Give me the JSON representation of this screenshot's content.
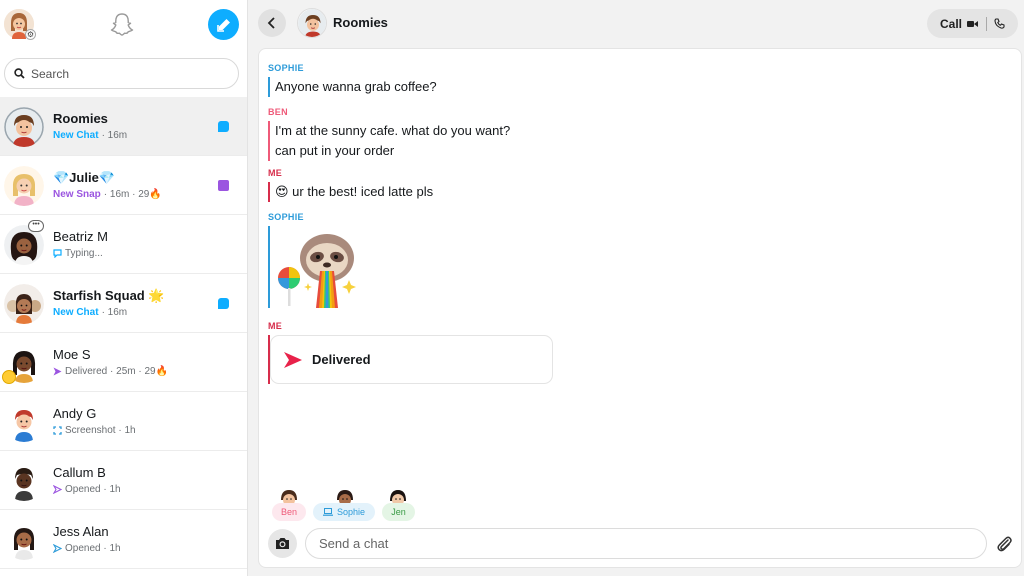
{
  "sidebar": {
    "search_placeholder": "Search",
    "chats": [
      {
        "name": "Roomies",
        "status_label": "New Chat",
        "status_meta": " · 16m",
        "indicator": "blue",
        "active": true,
        "bold": true,
        "label_color": "blue",
        "status_icon": "none"
      },
      {
        "name": "💎Julie💎",
        "status_label": "New Snap",
        "status_meta": " · 16m · 29🔥",
        "indicator": "purple",
        "active": false,
        "bold": true,
        "label_color": "purple",
        "status_icon": "none"
      },
      {
        "name": "Beatriz M",
        "status_label": "",
        "status_meta": "Typing...",
        "indicator": "none",
        "active": false,
        "bold": false,
        "label_color": "grey",
        "status_icon": "typing-chat-icon"
      },
      {
        "name": "Starfish Squad",
        "status_label": "New Chat",
        "status_meta": " · 16m",
        "indicator": "blue",
        "active": false,
        "bold": true,
        "label_color": "blue",
        "status_icon": "none"
      },
      {
        "name": "Moe S",
        "status_label": "",
        "status_meta": "Delivered · 25m · 29🔥",
        "indicator": "none",
        "active": false,
        "bold": false,
        "label_color": "grey",
        "status_icon": "delivered-arrow-icon"
      },
      {
        "name": "Andy G",
        "status_label": "",
        "status_meta": "Screenshot · 1h",
        "indicator": "none",
        "active": false,
        "bold": false,
        "label_color": "grey",
        "status_icon": "screenshot-icon"
      },
      {
        "name": "Callum B",
        "status_label": "",
        "status_meta": "Opened · 1h",
        "indicator": "none",
        "active": false,
        "bold": false,
        "label_color": "grey",
        "status_icon": "opened-arrow-icon"
      },
      {
        "name": "Jess Alan",
        "status_label": "",
        "status_meta": "Opened · 1h",
        "indicator": "none",
        "active": false,
        "bold": false,
        "label_color": "grey",
        "status_icon": "opened-arrow-icon"
      }
    ]
  },
  "header": {
    "title": "Roomies",
    "call_label": "Call"
  },
  "messages": [
    {
      "sender": "SOPHIE",
      "color": "#2d9bd9",
      "lines": [
        "Anyone wanna grab coffee?"
      ]
    },
    {
      "sender": "BEN",
      "color": "#ef5a79",
      "lines": [
        "I'm at the sunny cafe. what do you want?",
        "can put in your order"
      ]
    },
    {
      "sender": "ME",
      "color": "#d72d4b",
      "lines": [
        "😍 ur the best! iced latte pls"
      ]
    },
    {
      "sender": "SOPHIE",
      "color": "#2d9bd9",
      "sticker": "sloth-rainbow-sticker"
    },
    {
      "sender": "ME",
      "color": "#d72d4b",
      "card": "Delivered"
    }
  ],
  "read_receipts": [
    {
      "name": "Ben",
      "color": "#ef5a79",
      "bg": "#fde8ee"
    },
    {
      "name": "Sophie",
      "color": "#2d9bd9",
      "bg": "#e3f2fb"
    },
    {
      "name": "Jen",
      "color": "#3a9b46",
      "bg": "#e4f5e5"
    }
  ],
  "composer": {
    "placeholder": "Send a chat"
  },
  "colors": {
    "accent": "#0eadff",
    "new_snap": "#9b55e0",
    "me": "#d72d4b",
    "sophie": "#2d9bd9",
    "ben": "#ef5a79"
  }
}
